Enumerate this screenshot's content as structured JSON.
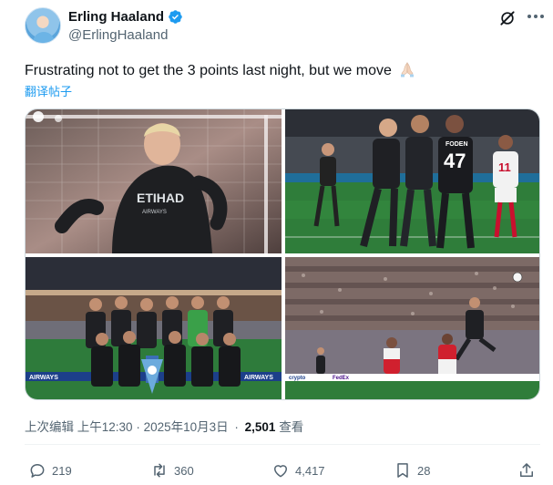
{
  "author": {
    "display_name": "Erling Haaland",
    "handle": "@ErlingHaaland",
    "verified": true
  },
  "tweet": {
    "text": "Frustrating not to get the 3 points last night, but we move",
    "emoji": "folded-hands",
    "translate_label": "翻译帖子"
  },
  "media": [
    {
      "description_icon": "photo"
    },
    {
      "description_icon": "photo",
      "jersey_numbers": [
        "47",
        "11"
      ],
      "shirt_name": "FODEN"
    },
    {
      "description_icon": "photo"
    },
    {
      "description_icon": "photo",
      "board_texts": [
        "AIRWAYS",
        "FedEx",
        "crypto"
      ]
    }
  ],
  "meta": {
    "edited_label": "上次编辑",
    "time": "上午12:30",
    "date": "2025年10月3日",
    "views_count": "2,501",
    "views_label": "查看"
  },
  "actions": {
    "replies": "219",
    "reposts": "360",
    "likes": "4,417",
    "bookmarks": "28"
  },
  "colors": {
    "accent": "#1d9bf0",
    "text": "#0f1419",
    "muted": "#536471",
    "pitch": "#2f7d3a"
  }
}
